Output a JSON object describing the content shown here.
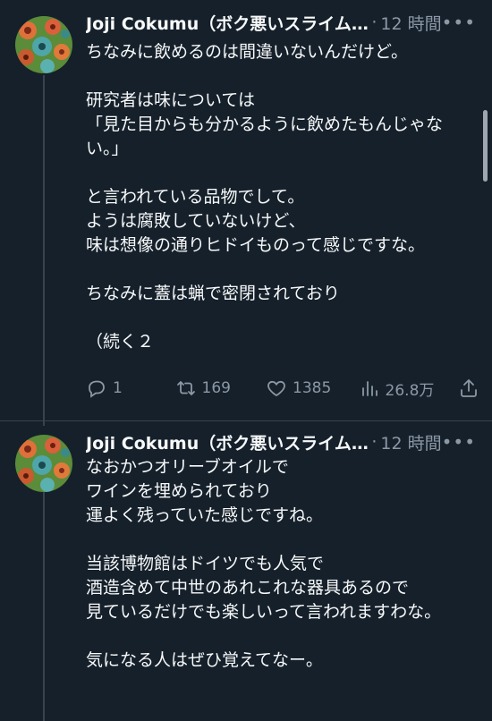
{
  "tweets": [
    {
      "author": "Joji Cokumu（ボク悪いスライムじゃないよ）",
      "time": "12 時間",
      "text": "ちなみに飲めるのは間違いないんだけど。\n\n研究者は味については\n「見た目からも分かるように飲めたもんじゃない。」\n\nと言われている品物でして。\nようは腐敗していないけど、\n味は想像の通りヒドイものって感じですな。\n\nちなみに蓋は蝋で密閉されており\n\n（続く２",
      "replies": "1",
      "retweets": "169",
      "likes": "1385",
      "views": "26.8万"
    },
    {
      "author": "Joji Cokumu（ボク悪いスライムじゃないよ）",
      "time": "12 時間",
      "text": "なおかつオリーブオイルで\nワインを埋められており\n運よく残っていた感じですね。\n\n当該博物館はドイツでも人気で\n酒造含めて中世のあれこれな器具あるので\n見ているだけでも楽しいって言われますわな。\n\n気になる人はぜひ覚えてなー。"
    }
  ],
  "icons": {
    "more": "more-icon",
    "reply": "reply-icon",
    "retweet": "retweet-icon",
    "like": "heart-icon",
    "views": "views-icon",
    "share": "share-icon"
  },
  "colors": {
    "background": "#15202b",
    "text": "#f7f9f9",
    "secondary": "#8b98a5",
    "line": "#38444d"
  }
}
